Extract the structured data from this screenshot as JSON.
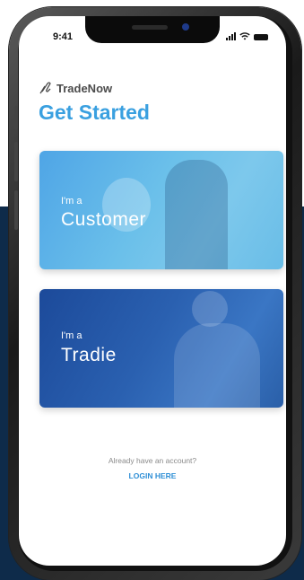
{
  "status_bar": {
    "time": "9:41"
  },
  "app": {
    "name": "TradeNow",
    "logo_icon": "tradenow-logo-icon"
  },
  "page": {
    "title": "Get Started"
  },
  "cards": [
    {
      "pre_label": "I'm a",
      "label": "Customer",
      "color": "#5fb4e8"
    },
    {
      "pre_label": "I'm a",
      "label": "Tradie",
      "color": "#2456a4"
    }
  ],
  "footer": {
    "account_prompt": "Already have an account?",
    "login_label": "LOGIN HERE"
  },
  "colors": {
    "accent": "#3aa0e0",
    "background": "#0e2b4a"
  }
}
